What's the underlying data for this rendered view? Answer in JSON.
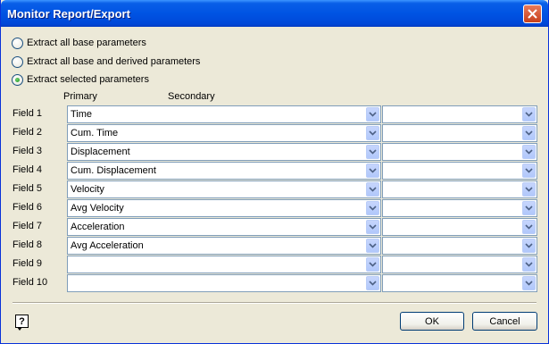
{
  "window": {
    "title": "Monitor Report/Export"
  },
  "options": [
    {
      "label": "Extract all base parameters",
      "checked": false
    },
    {
      "label": "Extract all base and derived parameters",
      "checked": false
    },
    {
      "label": "Extract selected parameters",
      "checked": true
    }
  ],
  "columns": {
    "primary": "Primary",
    "secondary": "Secondary"
  },
  "fields": [
    {
      "label": "Field  1",
      "primary": "Time",
      "secondary": ""
    },
    {
      "label": "Field  2",
      "primary": "Cum. Time",
      "secondary": ""
    },
    {
      "label": "Field  3",
      "primary": "Displacement",
      "secondary": ""
    },
    {
      "label": "Field  4",
      "primary": "Cum. Displacement",
      "secondary": ""
    },
    {
      "label": "Field  5",
      "primary": "Velocity",
      "secondary": ""
    },
    {
      "label": "Field  6",
      "primary": "Avg Velocity",
      "secondary": ""
    },
    {
      "label": "Field  7",
      "primary": "Acceleration",
      "secondary": ""
    },
    {
      "label": "Field  8",
      "primary": "Avg Acceleration",
      "secondary": ""
    },
    {
      "label": "Field  9",
      "primary": "",
      "secondary": ""
    },
    {
      "label": "Field 10",
      "primary": "",
      "secondary": ""
    }
  ],
  "buttons": {
    "ok": "OK",
    "cancel": "Cancel"
  },
  "icons": {
    "close": "close-icon",
    "help": "help-icon",
    "dropdown": "chevron-down-icon"
  }
}
